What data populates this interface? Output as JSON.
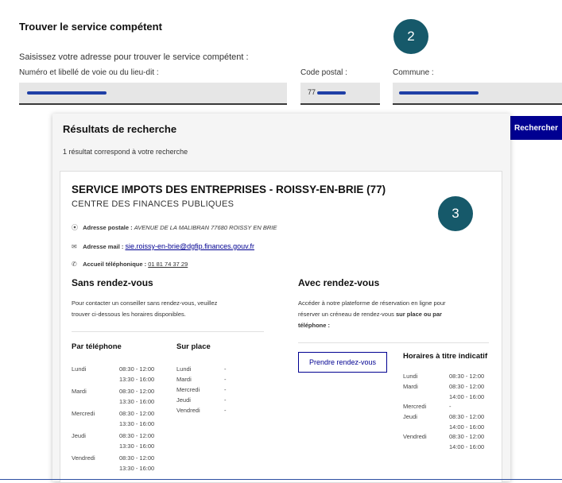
{
  "search_form": {
    "title": "Trouver le service compétent",
    "intro": "Saisissez votre adresse pour trouver le service compétent :",
    "street_label": "Numéro et libellé de voie ou du lieu-dit :",
    "postal_label": "Code postal :",
    "city_label": "Commune :",
    "street_value": "",
    "postal_value": "77",
    "city_value": "",
    "submit_label": "Rechercher"
  },
  "callouts": [
    "2",
    "3"
  ],
  "results": {
    "title": "Résultats de recherche",
    "count_text": "1 résultat correspond à votre recherche",
    "service": {
      "name": "SERVICE IMPOTS DES ENTREPRISES - ROISSY-EN-BRIE (77)",
      "subtitle": "CENTRE DES FINANCES PUBLIQUES",
      "postal_label": "Adresse postale :",
      "postal_value": "AVENUE DE LA MALIBRAN 77680 ROISSY EN BRIE",
      "mail_label": "Adresse mail :",
      "mail_value": "sie.roissy-en-brie@dgfip.finances.gouv.fr",
      "phone_label": "Accueil téléphonique :",
      "phone_value": "01 81 74 37 29"
    },
    "without_appointment": {
      "title": "Sans rendez-vous",
      "text_line1": "Pour contacter un conseiller sans rendez-vous, veuillez",
      "text_line2": "trouver ci-dessous les horaires disponibles.",
      "phone_heading": "Par téléphone",
      "onsite_heading": "Sur place",
      "phone_hours": [
        {
          "day": "Lundi",
          "am": "08:30 - 12:00",
          "pm": "13:30 - 16:00"
        },
        {
          "day": "Mardi",
          "am": "08:30 - 12:00",
          "pm": "13:30 - 16:00"
        },
        {
          "day": "Mercredi",
          "am": "08:30 - 12:00",
          "pm": "13:30 - 16:00"
        },
        {
          "day": "Jeudi",
          "am": "08:30 - 12:00",
          "pm": "13:30 - 16:00"
        },
        {
          "day": "Vendredi",
          "am": "08:30 - 12:00",
          "pm": "13:30 - 16:00"
        }
      ],
      "onsite_hours": [
        {
          "day": "Lundi",
          "value": "-"
        },
        {
          "day": "Mardi",
          "value": "-"
        },
        {
          "day": "Mercredi",
          "value": "-"
        },
        {
          "day": "Jeudi",
          "value": "-"
        },
        {
          "day": "Vendredi",
          "value": "-"
        }
      ]
    },
    "with_appointment": {
      "title": "Avec rendez-vous",
      "text_line1": "Accéder à notre plateforme de réservation en ligne pour",
      "text_line2_pre": "réserver un créneau de rendez-vous ",
      "text_line2_bold": "sur place ou par",
      "text_line3": "téléphone :",
      "button_label": "Prendre rendez-vous",
      "hours_heading": "Horaires à titre indicatif",
      "hours": [
        {
          "day": "Lundi",
          "am": "08:30 - 12:00",
          "pm": ""
        },
        {
          "day": "Mardi",
          "am": "08:30 - 12:00",
          "pm": "14:00 - 16:00"
        },
        {
          "day": "Mercredi",
          "am": "-",
          "pm": ""
        },
        {
          "day": "Jeudi",
          "am": "08:30 - 12:00",
          "pm": "14:00 - 16:00"
        },
        {
          "day": "Vendredi",
          "am": "08:30 - 12:00",
          "pm": "14:00 - 16:00"
        }
      ]
    }
  },
  "icons": {
    "postal": "map-pin-icon",
    "mail": "envelope-icon",
    "phone": "phone-icon"
  },
  "colors": {
    "primary_blue": "#000091",
    "callout_teal": "#16596a",
    "field_bg": "#e6e6e6"
  }
}
